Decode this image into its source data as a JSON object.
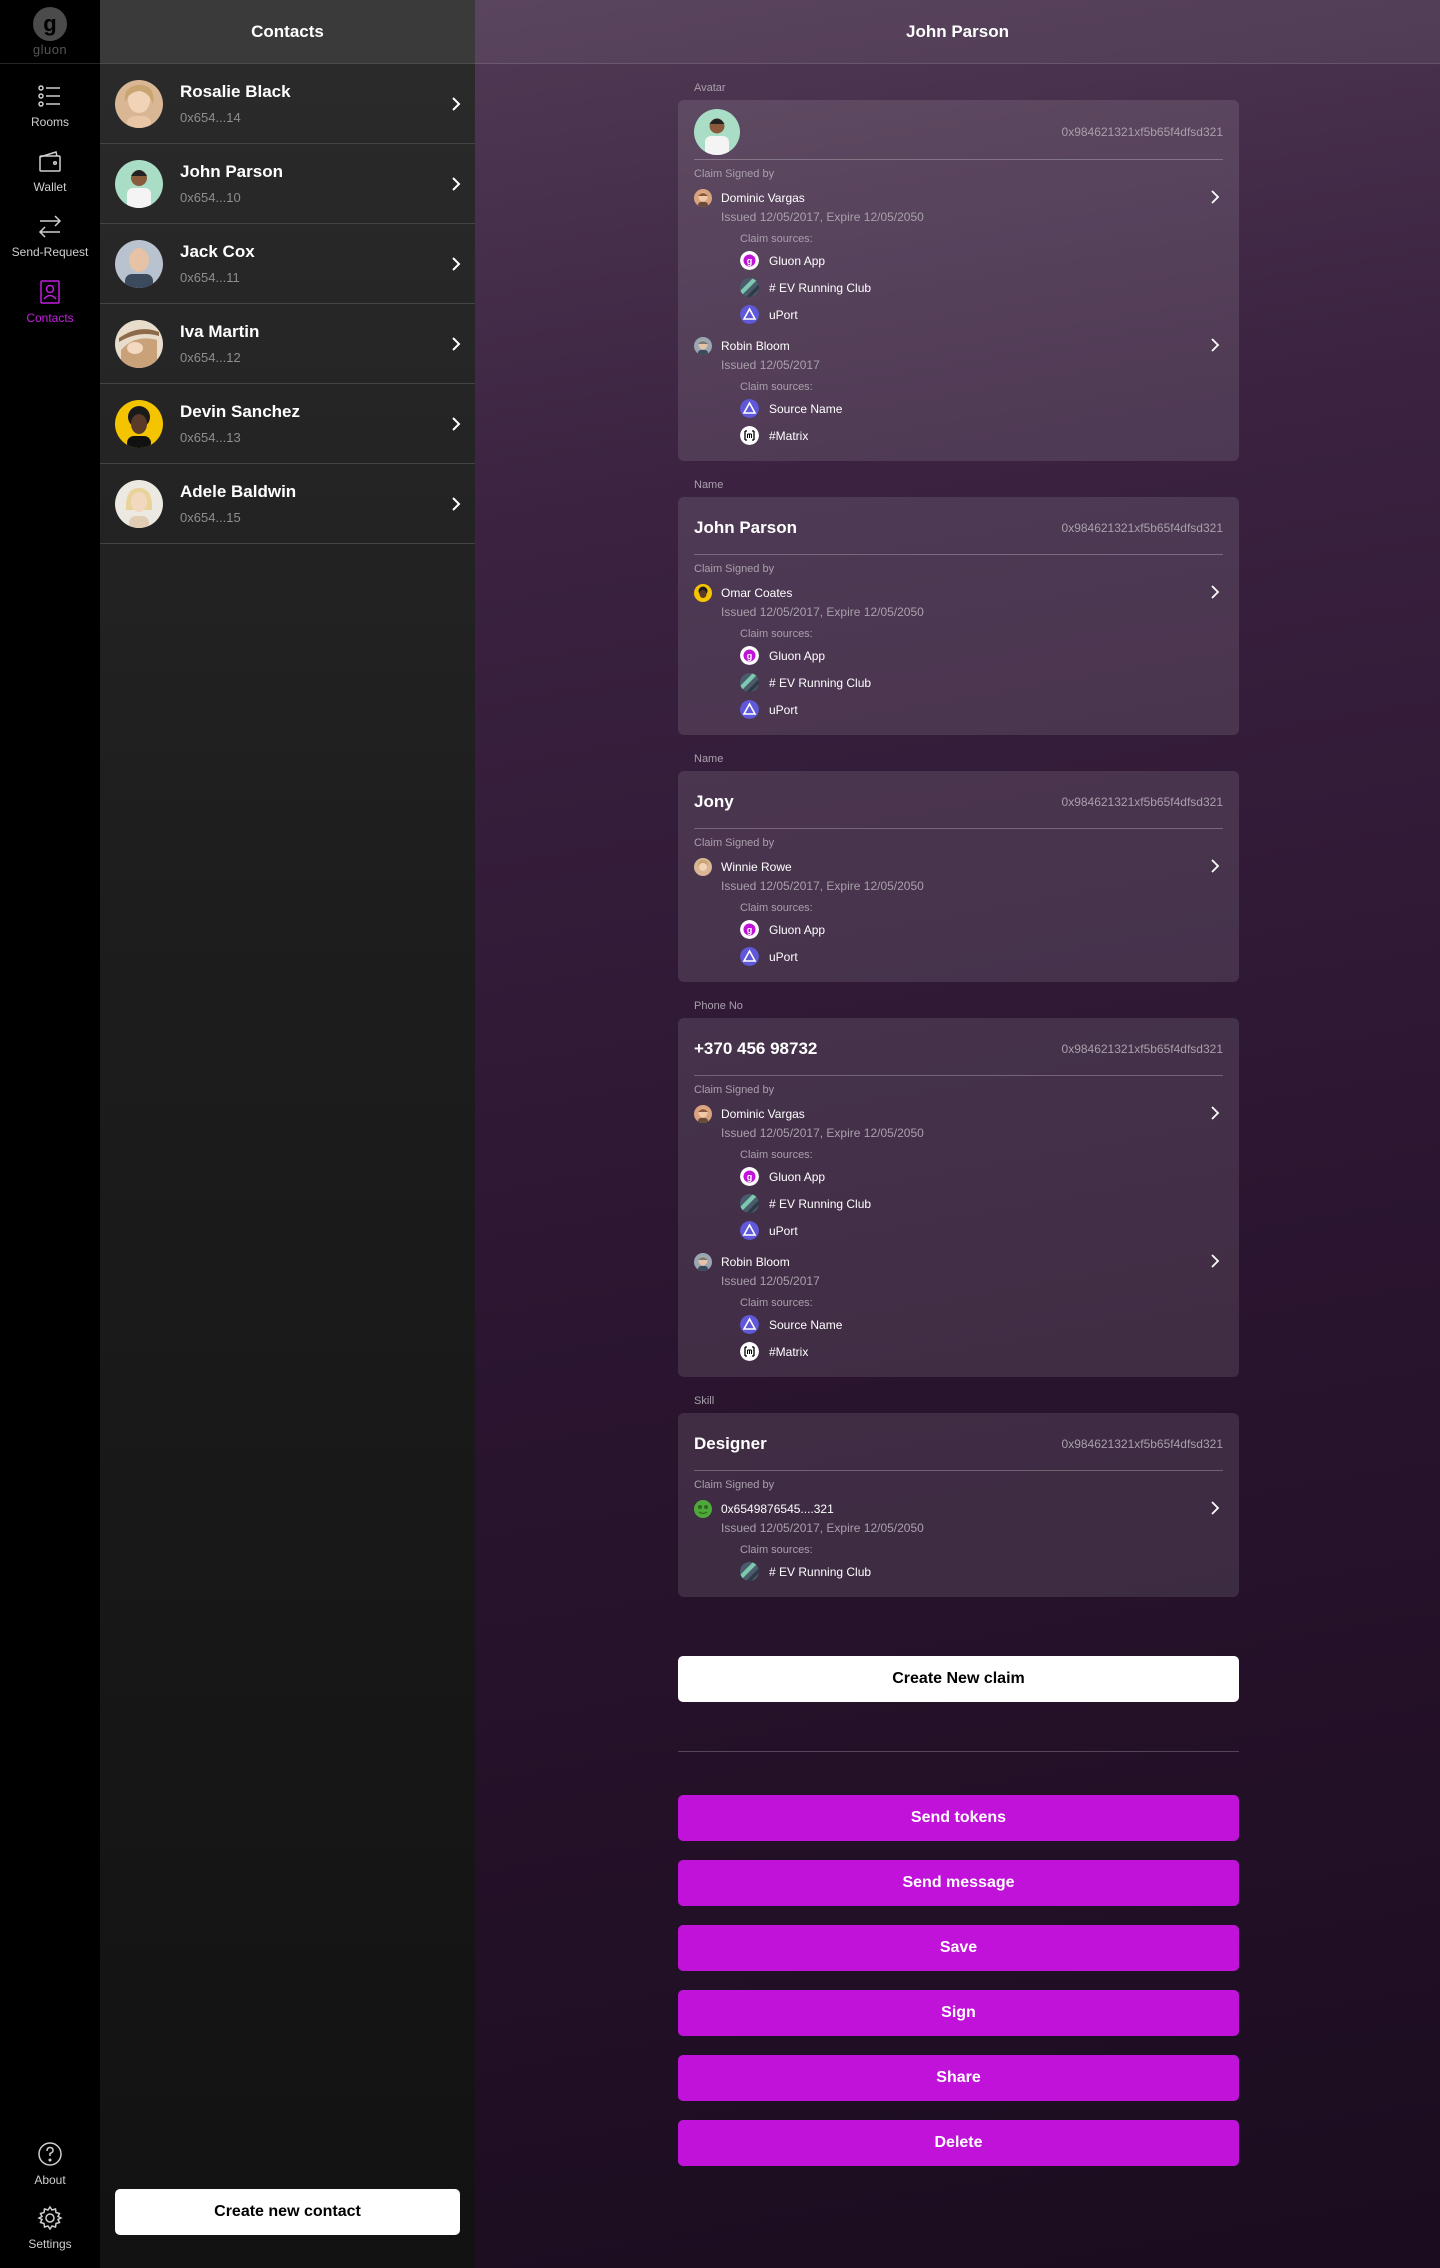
{
  "nav": {
    "logo_text": "gluon",
    "logo_mark": "g",
    "items": [
      {
        "label": "Rooms",
        "icon": "list-icon"
      },
      {
        "label": "Wallet",
        "icon": "wallet-icon"
      },
      {
        "label": "Send-Request",
        "icon": "transfer-icon"
      },
      {
        "label": "Contacts",
        "icon": "contacts-icon",
        "active": true
      }
    ],
    "about_label": "About",
    "settings_label": "Settings"
  },
  "contacts": {
    "title": "Contacts",
    "list": [
      {
        "name": "Rosalie Black",
        "address": "0x654...14"
      },
      {
        "name": "John Parson",
        "address": "0x654...10"
      },
      {
        "name": "Jack Cox",
        "address": "0x654...11"
      },
      {
        "name": "Iva Martin",
        "address": "0x654...12"
      },
      {
        "name": "Devin Sanchez",
        "address": "0x654...13"
      },
      {
        "name": "Adele Baldwin",
        "address": "0x654...15"
      }
    ],
    "create_button": "Create new contact"
  },
  "detail": {
    "title": "John Parson",
    "claim_signed_by_label": "Claim Signed by",
    "claim_sources_label": "Claim sources:",
    "claims": [
      {
        "label": "Avatar",
        "value": "",
        "address": "0x984621321xf5b65f4dfsd321",
        "signers": [
          {
            "name": "Dominic Vargas",
            "issued": "Issued 12/05/2017, Expire 12/05/2050",
            "sources": [
              "Gluon App",
              "# EV Running Club",
              "uPort"
            ]
          },
          {
            "name": "Robin Bloom",
            "issued": "Issued 12/05/2017",
            "sources": [
              "Source Name",
              "#Matrix"
            ]
          }
        ]
      },
      {
        "label": "Name",
        "value": "John Parson",
        "address": "0x984621321xf5b65f4dfsd321",
        "signers": [
          {
            "name": "Omar Coates",
            "issued": "Issued 12/05/2017, Expire 12/05/2050",
            "sources": [
              "Gluon App",
              "# EV Running Club",
              "uPort"
            ]
          }
        ]
      },
      {
        "label": "Name",
        "value": "Jony",
        "address": "0x984621321xf5b65f4dfsd321",
        "signers": [
          {
            "name": "Winnie Rowe",
            "issued": "Issued 12/05/2017, Expire 12/05/2050",
            "sources": [
              "Gluon App",
              "uPort"
            ]
          }
        ]
      },
      {
        "label": "Phone No",
        "value": "+370 456 98732",
        "address": "0x984621321xf5b65f4dfsd321",
        "signers": [
          {
            "name": "Dominic Vargas",
            "issued": "Issued 12/05/2017, Expire 12/05/2050",
            "sources": [
              "Gluon App",
              "# EV Running Club",
              "uPort"
            ]
          },
          {
            "name": "Robin Bloom",
            "issued": "Issued 12/05/2017",
            "sources": [
              "Source Name",
              "#Matrix"
            ]
          }
        ]
      },
      {
        "label": "Skill",
        "value": "Designer",
        "address": "0x984621321xf5b65f4dfsd321",
        "signers": [
          {
            "name": "0x6549876545....321",
            "issued": "Issued 12/05/2017, Expire 12/05/2050",
            "sources": [
              "# EV Running Club"
            ]
          }
        ]
      }
    ],
    "create_claim_button": "Create New claim",
    "actions": [
      "Send tokens",
      "Send message",
      "Save",
      "Sign",
      "Share",
      "Delete"
    ]
  },
  "colors": {
    "accent": "#c112da",
    "active_nav": "#c41ce0"
  }
}
